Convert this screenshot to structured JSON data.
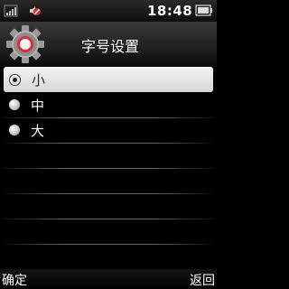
{
  "status_bar": {
    "time": "18:48",
    "icons": [
      "signal-icon",
      "silent-icon",
      "battery-icon"
    ]
  },
  "header": {
    "title": "字号设置",
    "icon": "gear-icon"
  },
  "options": [
    {
      "label": "小",
      "selected": true
    },
    {
      "label": "中",
      "selected": false
    },
    {
      "label": "大",
      "selected": false
    }
  ],
  "softkeys": {
    "left": "确定",
    "right": "返回"
  },
  "colors": {
    "gear_accent": "#e0293b",
    "selected_bg": "#e8e8e8"
  }
}
